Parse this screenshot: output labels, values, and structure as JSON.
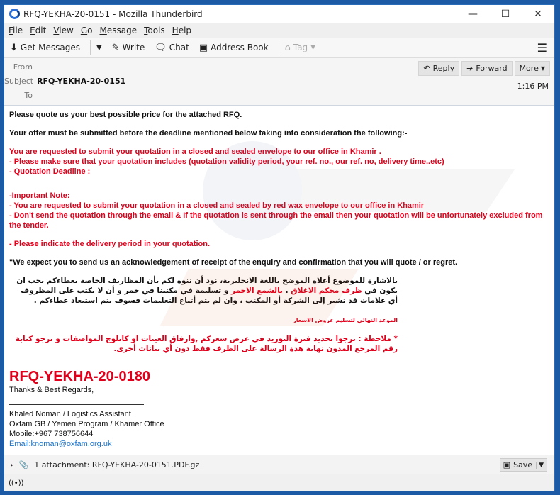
{
  "window": {
    "title": "RFQ-YEKHA-20-0151 - Mozilla Thunderbird",
    "minimize": "—",
    "maximize": "☐",
    "close": "✕"
  },
  "menu": [
    "File",
    "Edit",
    "View",
    "Go",
    "Message",
    "Tools",
    "Help"
  ],
  "toolbar": {
    "get_messages": "Get Messages",
    "write": "Write",
    "chat": "Chat",
    "address_book": "Address Book",
    "tag": "Tag"
  },
  "header": {
    "from_label": "From",
    "subject_label": "Subject",
    "to_label": "To",
    "subject": "RFQ-YEKHA-20-0151",
    "time": "1:16 PM",
    "reply": "Reply",
    "forward": "Forward",
    "more": "More"
  },
  "body": {
    "line1": "Please quote us your best possible price for the attached RFQ.",
    "line2": "Your offer must be submitted before the deadline mentioned below taking into consideration the following:-",
    "red1": "You are requested to submit your quotation in a closed and sealed envelope to our office in Khamir .",
    "red2": "- Please make sure that your quotation includes (quotation validity period, your ref. no., our ref. no, delivery time..etc)",
    "red3": "- Quotation Deadline :",
    "note_title": "-Important Note:",
    "note1": "- You are requested to submit your quotation in a closed and sealed by red wax envelope to our office in Khamir",
    "note2": "- Don't send the quotation through the email & If the quotation is sent through the email then your quotation will be unfortunately excluded from the tender.",
    "delivery": "- Please indicate the delivery period in your quotation.",
    "expect": "\"We expect you to send us an acknowledgement of receipt of the enquiry and confirmation that you will quote / or regret.",
    "arabic1_a": "بالاشارة للموضوع أعلاه الموضح باللغة الانجليزية، نود أن ننوه لكم بأن المظاريف الخاصة بعطاءكم يجب ان يكون في ",
    "arabic1_red1": "ظرف محكم الاغلاق",
    "arabic1_b": " . ",
    "arabic1_red2": "بالشمع الاحمر",
    "arabic1_c": " و تسليمة في مكتبنا في خمر و أن لا يكتب على المظروف أي علامات قد تشير إلى الشركة أو المكتب ، وان لم يتم أتباع التعليمات فسوف يتم استبعاد عطاءكم .",
    "arabic2": "الموعد النهائي لتسليم عروض الاسعار",
    "arabic3": "* ملاحظة : نرجوا تحديد فترة التوريد في عرض سعركم ,وارفاق العينات او كاتلوج المواصفات و نرجو كتابة رقم المرجع المدون نهاية هذة الرسالة على الظرف فقط دون أي بيانات أخرى.",
    "ref": "RFQ-YEKHA-20-0180",
    "regards": "Thanks & Best Regards,",
    "sig_name": "Khaled Noman / Logistics Assistant",
    "sig_org": "Oxfam GB / Yemen Program / Khamer Office",
    "sig_mobile": "Mobile:+967 738756644",
    "sig_email": "Email:knoman@oxfam.org.uk"
  },
  "attachment": {
    "label": "1 attachment: RFQ-YEKHA-20-0151.PDF.gz",
    "save": "Save"
  }
}
